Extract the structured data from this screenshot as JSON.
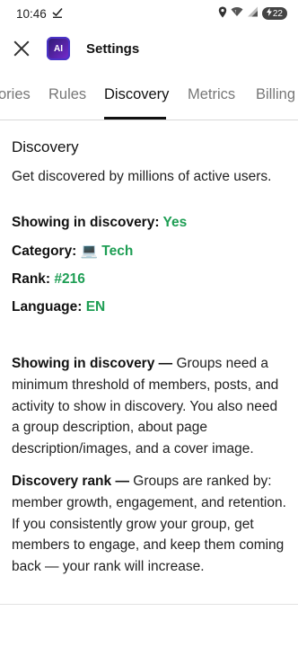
{
  "status": {
    "time": "10:46",
    "battery": "22"
  },
  "header": {
    "title": "Settings",
    "logo_text": "AI"
  },
  "tabs": [
    {
      "label": "ories"
    },
    {
      "label": "Rules"
    },
    {
      "label": "Discovery"
    },
    {
      "label": "Metrics"
    },
    {
      "label": "Billing"
    }
  ],
  "discovery": {
    "title": "Discovery",
    "subtitle": "Get discovered by millions of active users.",
    "showing_label": "Showing in discovery:",
    "showing_value": "Yes",
    "category_label": "Category:",
    "category_emoji": "💻",
    "category_value": "Tech",
    "rank_label": "Rank:",
    "rank_value": "#216",
    "language_label": "Language:",
    "language_value": "EN"
  },
  "info": {
    "showing_heading": "Showing in discovery —",
    "showing_text": " Groups need a minimum threshold of members, posts, and activity to show in discovery. You also need a group description, about page description/images, and a cover image.",
    "rank_heading": "Discovery rank —",
    "rank_text": " Groups are ranked by: member growth, engagement, and retention. If you consistently grow your group, get members to engage, and keep them coming back — your rank will increase."
  },
  "colors": {
    "accent_green": "#1e9e54"
  }
}
